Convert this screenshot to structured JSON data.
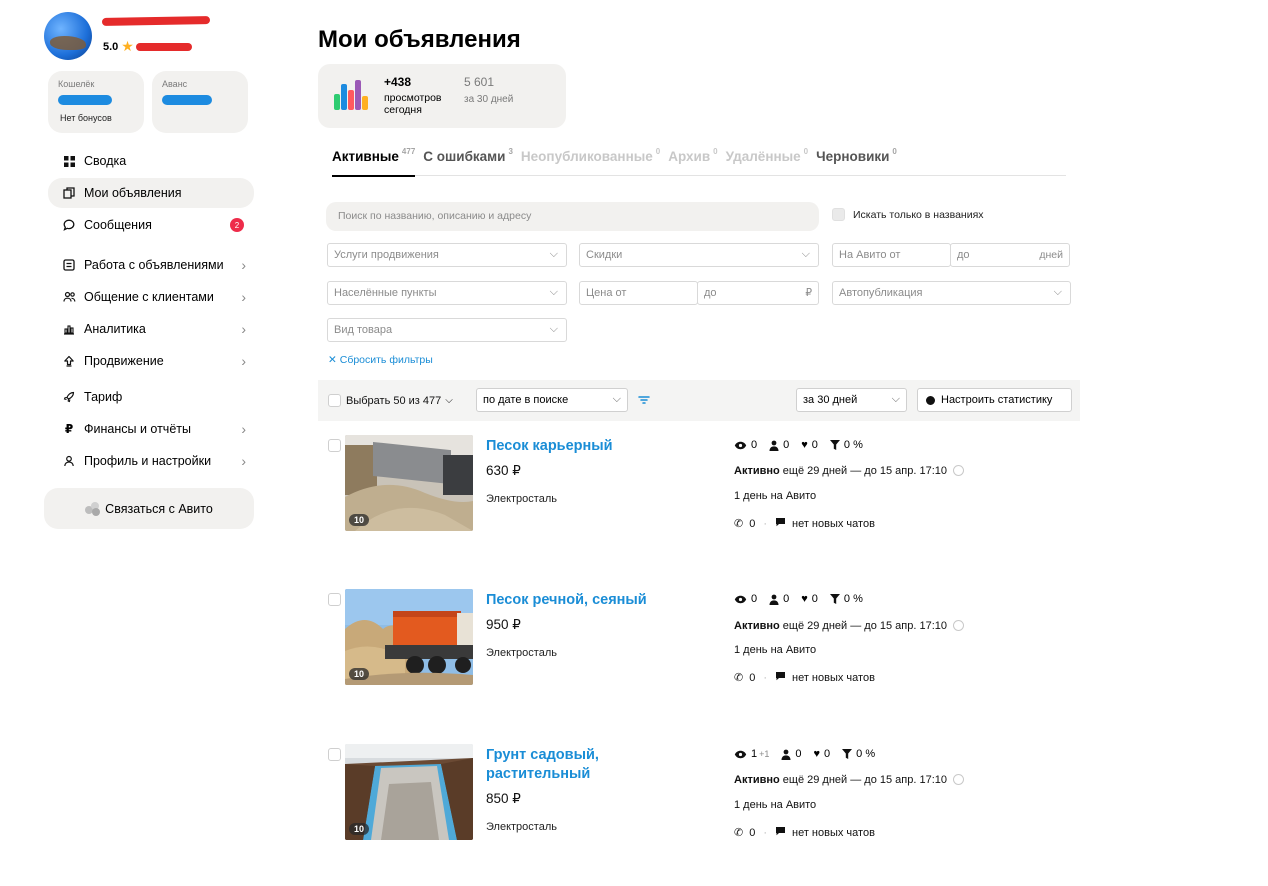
{
  "profile": {
    "rating": "5.0"
  },
  "wallet": {
    "label": "Кошелёк",
    "bonus": "Нет бонусов"
  },
  "advance": {
    "label": "Аванс"
  },
  "nav": {
    "summary": "Сводка",
    "my_ads": "Мои объявления",
    "messages": "Сообщения",
    "messages_badge": "2",
    "ads_work": "Работа с объявлениями",
    "clients": "Общение с клиентами",
    "analytics": "Аналитика",
    "promotion": "Продвижение",
    "tariff": "Тариф",
    "finance": "Финансы и отчёты",
    "profile_settings": "Профиль и настройки"
  },
  "contact_button": "Связаться с Авито",
  "page_title": "Мои объявления",
  "stats": {
    "today_value": "+438",
    "today_label": "просмотров сегодня",
    "month_value": "5 601",
    "month_label": "за 30 дней"
  },
  "tabs": [
    {
      "label": "Активные",
      "count": "477"
    },
    {
      "label": "С ошибками",
      "count": "3"
    },
    {
      "label": "Неопубликованные",
      "count": "0"
    },
    {
      "label": "Архив",
      "count": "0"
    },
    {
      "label": "Удалённые",
      "count": "0"
    },
    {
      "label": "Черновики",
      "count": "0"
    }
  ],
  "filters": {
    "search_placeholder": "Поиск по названию, описанию и адресу",
    "only_titles": "Искать только в названиях",
    "promo_services": "Услуги продвижения",
    "discounts": "Скидки",
    "avito_from": "На Авито от",
    "avito_to": "до",
    "days": "дней",
    "localities": "Населённые пункты",
    "price_from": "Цена от",
    "price_to": "до",
    "currency": "₽",
    "autopublish": "Автопубликация",
    "product_type": "Вид товара",
    "reset": "Сбросить фильтры"
  },
  "toolbar": {
    "select_all": "Выбрать 50 из 477",
    "sort": "по дате в поиске",
    "period": "за 30 дней",
    "configure": "Настроить статистику"
  },
  "listings": [
    {
      "title": "Песок карьерный",
      "price": "630 ₽",
      "city": "Электросталь",
      "photos": "10",
      "views": "0",
      "contacts": "0",
      "favorites": "0",
      "conversion": "0 %",
      "status": "Активно",
      "status_detail": "ещё 29 дней — до 15 апр. 17:10",
      "days_on": "1 день на Авито",
      "calls": "0",
      "chats": "нет новых чатов"
    },
    {
      "title": "Песок речной, сеяный",
      "price": "950 ₽",
      "city": "Электросталь",
      "photos": "10",
      "views": "0",
      "contacts": "0",
      "favorites": "0",
      "conversion": "0 %",
      "status": "Активно",
      "status_detail": "ещё 29 дней — до 15 апр. 17:10",
      "days_on": "1 день на Авито",
      "calls": "0",
      "chats": "нет новых чатов"
    },
    {
      "title": "Грунт садовый, растительный",
      "price": "850 ₽",
      "city": "Электросталь",
      "photos": "10",
      "views": "1",
      "views_plus": "+1",
      "contacts": "0",
      "favorites": "0",
      "conversion": "0 %",
      "status": "Активно",
      "status_detail": "ещё 29 дней — до 15 апр. 17:10",
      "days_on": "1 день на Авито",
      "calls": "0",
      "chats": "нет новых чатов"
    }
  ]
}
